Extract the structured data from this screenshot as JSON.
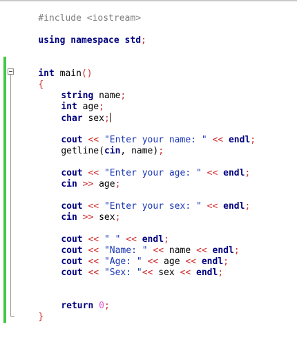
{
  "code": {
    "include_line": "#include <iostream>",
    "using_kw": "using namespace",
    "using_ns": "std",
    "using_semicolon": ";",
    "main_kw": "int",
    "main_name": " main",
    "main_parens": "()",
    "open_brace": "{",
    "close_brace": "}",
    "decl_string_type": "string",
    "decl_string_name": " name",
    "decl_int_type": "int",
    "decl_int_name": " age",
    "decl_char_type": "char",
    "decl_char_name": " sex",
    "semicolon": ";",
    "cout": "cout",
    "cin": "cin",
    "endl": "endl",
    "insert_op": " << ",
    "extract_op": " >> ",
    "getline_fn": "getline(",
    "getline_sep": ", name)",
    "name_var": "name",
    "age_var": "age",
    "sex_var": "sex",
    "str_name_prompt": "\"Enter your name: \"",
    "str_age_prompt": "\"Enter your age: \"",
    "str_sex_prompt": "\"Enter your sex: \"",
    "str_space": "\" \"",
    "str_name_label": "\"Name: \"",
    "str_age_label": "\"Age: \"",
    "str_sex_label": "\"Sex: \"",
    "return_kw": "return",
    "return_value": " 0"
  },
  "colors": {
    "keyword": "#00007f",
    "operator": "#d02a2a",
    "string": "#1a35b5",
    "number": "#e05acb",
    "preprocessor": "#7f7f7f",
    "change_bar": "#44c744"
  }
}
